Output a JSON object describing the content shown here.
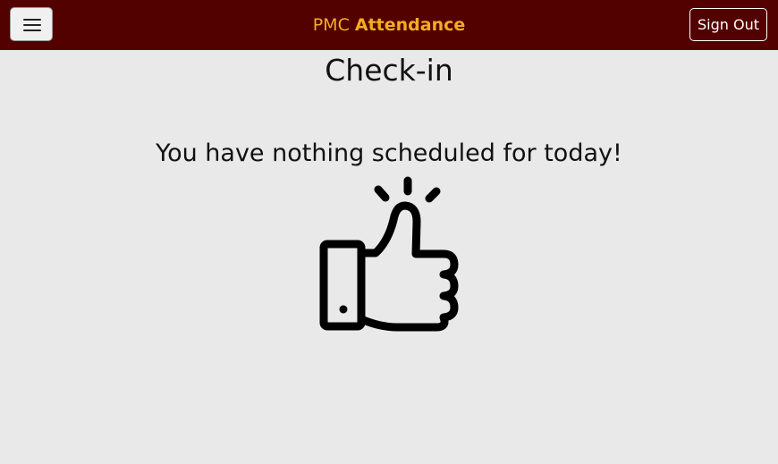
{
  "header": {
    "brand_prefix": "PMC",
    "brand_main": "Attendance",
    "sign_out_label": "Sign Out",
    "menu_icon": "hamburger-menu-icon",
    "background_color": "#530000",
    "brand_color": "#f2ad22"
  },
  "main": {
    "title": "Check-in",
    "message": "You have nothing scheduled for today!",
    "illustration_icon": "thumbs-up-icon"
  }
}
